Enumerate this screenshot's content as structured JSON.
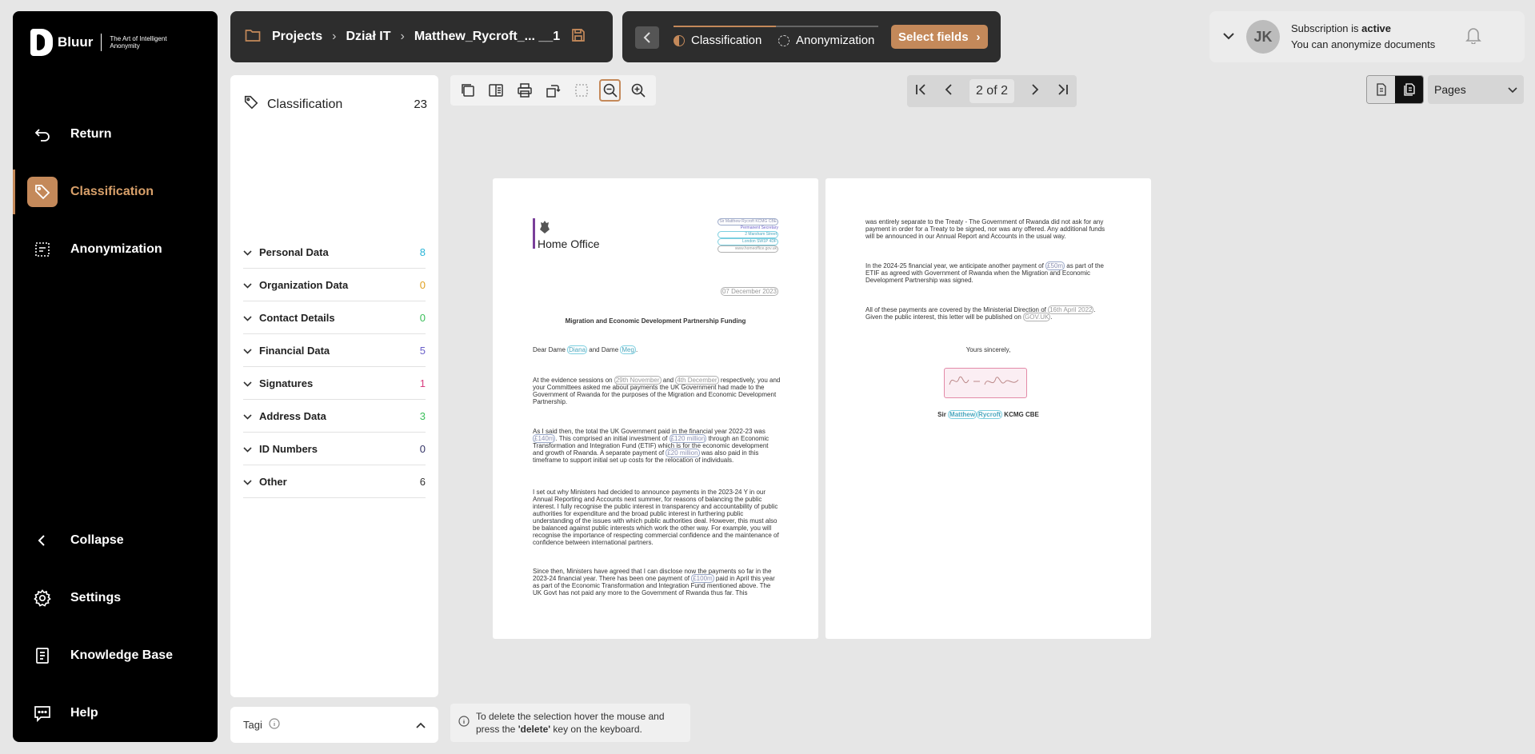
{
  "sidebar": {
    "logo_name": "Bluur",
    "logo_tagline": "The Art of Intelligent Anonymity",
    "return": "Return",
    "classification": "Classification",
    "anonymization": "Anonymization",
    "collapse": "Collapse",
    "settings": "Settings",
    "knowledge_base": "Knowledge Base",
    "help": "Help",
    "accent": "#c4895a"
  },
  "breadcrumb": {
    "projects": "Projects",
    "folder": "Dział IT",
    "file": "Matthew_Rycroft_... __1"
  },
  "steps": {
    "classification": "Classification",
    "anonymization": "Anonymization",
    "select_fields": "Select fields"
  },
  "user": {
    "initials": "JK",
    "sub_line1_prefix": "Subscription is ",
    "sub_line1_status": "active",
    "sub_line2": "You can anonymize documents"
  },
  "panel": {
    "title": "Classification",
    "total": "23",
    "categories": [
      {
        "label": "Personal Data",
        "count": "8",
        "color": "#2bb5d8"
      },
      {
        "label": "Organization Data",
        "count": "0",
        "color": "#e0a020"
      },
      {
        "label": "Contact Details",
        "count": "0",
        "color": "#3bbf5a"
      },
      {
        "label": "Financial Data",
        "count": "5",
        "color": "#6a5fc9"
      },
      {
        "label": "Signatures",
        "count": "1",
        "color": "#d94080"
      },
      {
        "label": "Address Data",
        "count": "3",
        "color": "#3bbf5a"
      },
      {
        "label": "ID Numbers",
        "count": "0",
        "color": "#333366"
      },
      {
        "label": "Other",
        "count": "6",
        "color": "#333333"
      }
    ],
    "tags": "Tagi"
  },
  "pager": {
    "label": "2 of 2"
  },
  "view": {
    "pages": "Pages"
  },
  "hint": {
    "line1": "To delete the selection hover the mouse and",
    "line2_pre": "press the ",
    "line2_key": "'delete'",
    "line2_post": " key on the keyboard."
  },
  "doc": {
    "org": "Home Office",
    "header_name": "Sir Matthew Rycroft KCMG CBE",
    "header_role": "Permanent Secretary",
    "header_addr1": "2 Marsham Street",
    "header_addr2": "London SW1P 4DF",
    "header_web": "www.homeoffice.gov.uk",
    "date": "07 December 2023",
    "title": "Migration and Economic Development Partnership Funding",
    "salutation_pre": "Dear Dame ",
    "name1": "Diana",
    "salutation_mid": " and Dame ",
    "name2": "Meg",
    "para1_a": "At the evidence sessions on ",
    "para1_d1": "29th November",
    "para1_b": " and ",
    "para1_d2": "4th December",
    "para1_c": " respectively, you and your Committees asked me about payments the UK Government had made to the Government of Rwanda for the purposes of the Migration and Economic Development Partnership.",
    "para2_a": "As I said then, the total the UK Government paid in the financial year 2022-23 was ",
    "para2_v1": "£140m",
    "para2_b": ". This comprised an initial investment of ",
    "para2_v2": "£120 million",
    "para2_c": " through an Economic Transformation and Integration Fund (ETIF) which is for the economic development and growth of Rwanda. A separate payment of ",
    "para2_v3": "£20 million",
    "para2_d": " was also paid in this timeframe to support initial set up costs for the relocation of individuals.",
    "para3": "I set out why Ministers had decided to announce payments in the 2023-24 Y in our Annual Reporting and Accounts next summer, for reasons of balancing the public interest. I fully recognise the public interest in transparency and accountability of public authorities for expenditure and the broad public interest in furthering public understanding of the issues with which public authorities deal. However, this must also be balanced against public interests which work the other way. For example, you will recognise the importance of respecting commercial confidence and the maintenance of confidence between international partners.",
    "para4_a": "Since then, Ministers have agreed that I can disclose now the payments so far in the 2023-24 financial year. There has been one payment of ",
    "para4_v": "£100m",
    "para4_b": " paid in April this year as part of the Economic Transformation and Integration Fund mentioned above. The UK Govt has not paid any more to the Government of Rwanda thus far. This",
    "p2_para1": "was entirely separate to the Treaty - The Government of Rwanda did not ask for any payment in order for a Treaty to be signed, nor was any offered. Any additional funds will be announced in our Annual Report and Accounts in the usual way.",
    "p2_para2_a": "In the 2024-25 financial year, we anticipate another payment of ",
    "p2_para2_v": "£50m",
    "p2_para2_b": " as part of the ETIF as agreed with Government of Rwanda when the Migration and Economic Development Partnership was signed.",
    "p2_para3_a": "All of these payments are covered by the Ministerial Direction of ",
    "p2_para3_d": "16th April 2022",
    "p2_para3_b": ". Given the public interest, this letter will be published on ",
    "p2_para3_w": "GOV.UK",
    "p2_para3_c": ".",
    "closing": "Yours sincerely,",
    "sig_pre": "Sir ",
    "sig_first": "Matthew",
    "sig_last": "Rycroft",
    "sig_post": " KCMG CBE"
  }
}
